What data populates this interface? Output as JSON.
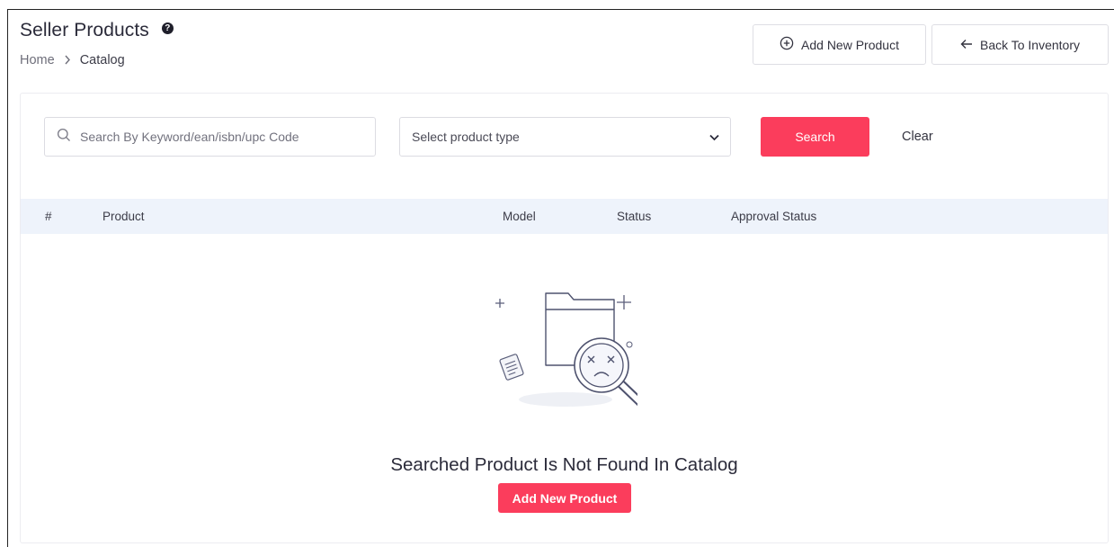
{
  "header": {
    "title": "Seller Products",
    "help_icon": "question-circle-icon",
    "breadcrumb": {
      "home": "Home",
      "current": "Catalog"
    },
    "add_new_product_label": "Add New Product",
    "back_to_inventory_label": "Back To Inventory"
  },
  "filters": {
    "search_placeholder": "Search By Keyword/ean/isbn/upc Code",
    "search_value": "",
    "product_type_selected": "Select product type",
    "search_button_label": "Search",
    "clear_label": "Clear"
  },
  "table": {
    "columns": [
      "#",
      "Product",
      "Model",
      "Status",
      "Approval Status"
    ],
    "rows": []
  },
  "empty_state": {
    "icon": "empty-folder-search-icon",
    "message": "Searched Product Is Not Found In Catalog",
    "button_label": "Add New Product"
  },
  "colors": {
    "accent": "#fb3d5c",
    "table_header_bg": "#eef3fb",
    "text": "#2b2b3a"
  }
}
